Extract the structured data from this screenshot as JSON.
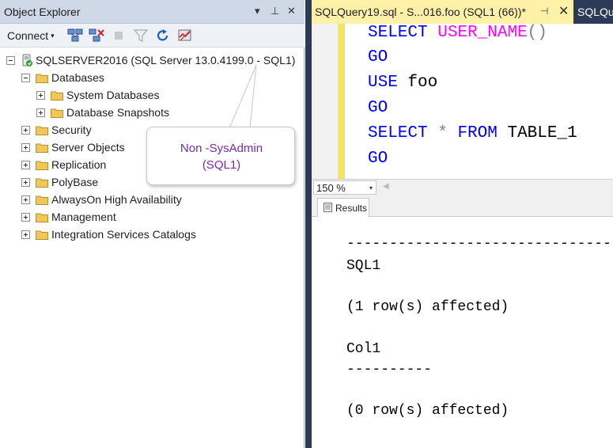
{
  "object_explorer": {
    "title": "Object Explorer",
    "title_controls": {
      "dropdown": "▾",
      "pin": "⊥",
      "close": "✕"
    },
    "toolbar": {
      "connect_label": "Connect",
      "connect_caret": "▾"
    },
    "tree": {
      "root": "SQLSERVER2016 (SQL Server 13.0.4199.0 - SQL1)",
      "databases": "Databases",
      "system_databases": "System Databases",
      "database_snapshots": "Database Snapshots",
      "security": "Security",
      "server_objects": "Server Objects",
      "replication": "Replication",
      "polybase": "PolyBase",
      "alwayson": "AlwaysOn High Availability",
      "management": "Management",
      "integration_services": "Integration Services Catalogs"
    }
  },
  "callout": {
    "line1": "Non -SysAdmin",
    "line2": "(SQL1)"
  },
  "doc_tabs": {
    "active_label": "SQLQuery19.sql - S...016.foo (SQL1 (66))*",
    "active_pin": "⊣",
    "active_close": "✕",
    "second_label": "SQLQu"
  },
  "editor": {
    "l1_kw": "SELECT",
    "l1_fn": "USER_NAME",
    "l1_paren": "()",
    "l2_kw": "GO",
    "l3_kw": "USE",
    "l3_txt": " foo",
    "l4_kw": "GO",
    "l5_kw": "SELECT",
    "l5_op": "*",
    "l5_kw2": "FROM",
    "l5_txt": " TABLE_1",
    "l6_kw": "GO"
  },
  "zoom": {
    "value": "150 %",
    "caret": "▾",
    "scroll_left": "◀"
  },
  "results_tab": {
    "label": "Results"
  },
  "results": {
    "line1": "--------------------------------",
    "line2": "SQL1",
    "line3": "(1 row(s) affected)",
    "line4": "Col1",
    "line5": "----------",
    "line6": "(0 row(s) affected)"
  },
  "colors": {
    "title_bar": "#cfd8e6",
    "doc_background": "#2c3a57",
    "active_tab": "#fff1a8",
    "keyword": "#0000ff",
    "function": "#ff00ff",
    "callout_text": "#7a2aa8"
  }
}
